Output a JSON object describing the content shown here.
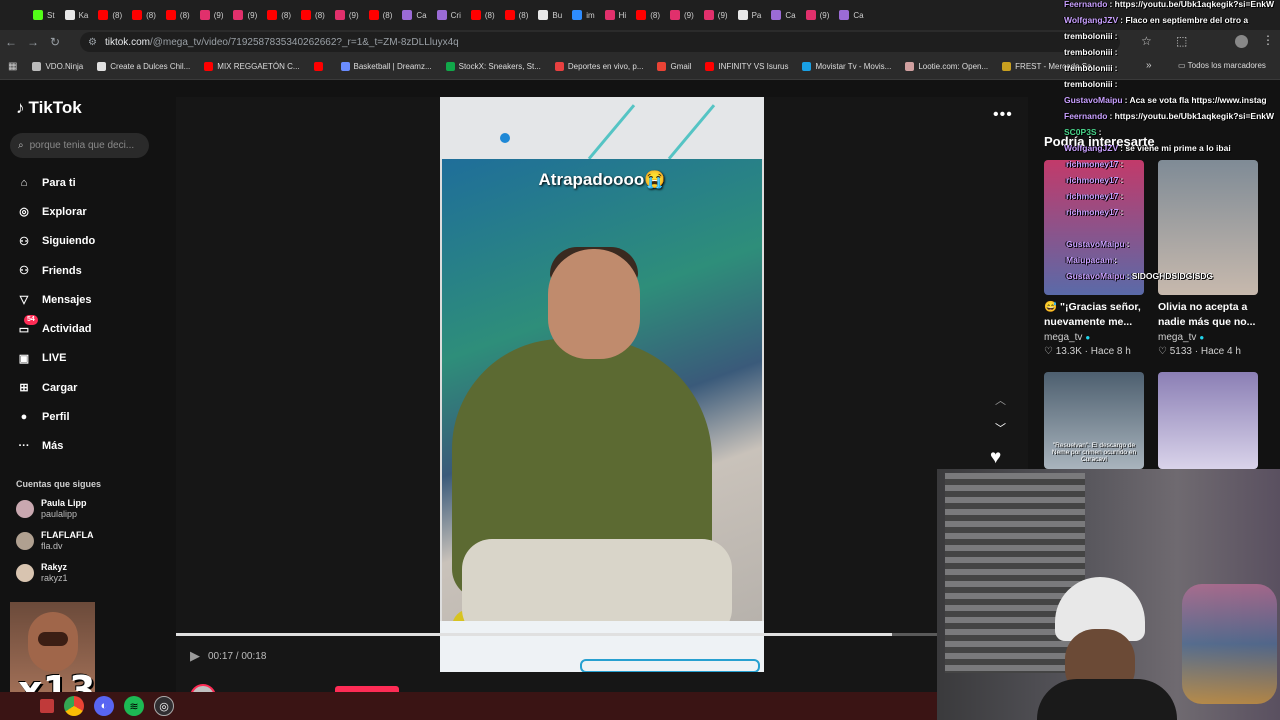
{
  "tabs": [
    {
      "label": "St",
      "color": "#53fc18"
    },
    {
      "label": "Ka",
      "color": "#e8e8e8"
    },
    {
      "label": "(8)",
      "color": "#ff0000"
    },
    {
      "label": "(8)",
      "color": "#ff0000"
    },
    {
      "label": "(8)",
      "color": "#ff0000"
    },
    {
      "label": "(9)",
      "color": "#e1306c"
    },
    {
      "label": "(9)",
      "color": "#e1306c"
    },
    {
      "label": "(8)",
      "color": "#ff0000"
    },
    {
      "label": "(8)",
      "color": "#ff0000"
    },
    {
      "label": "(9)",
      "color": "#e1306c"
    },
    {
      "label": "(8)",
      "color": "#ff0000"
    },
    {
      "label": "Ca",
      "color": "#9b6bd6"
    },
    {
      "label": "Cri",
      "color": "#9b6bd6"
    },
    {
      "label": "(8)",
      "color": "#ff0000"
    },
    {
      "label": "(8)",
      "color": "#ff0000"
    },
    {
      "label": "Bu",
      "color": "#e8e8e8"
    },
    {
      "label": "im",
      "color": "#2d8cff"
    },
    {
      "label": "Hi",
      "color": "#e1306c"
    },
    {
      "label": "(8)",
      "color": "#ff0000"
    },
    {
      "label": "(9)",
      "color": "#e1306c"
    },
    {
      "label": "(9)",
      "color": "#e1306c"
    },
    {
      "label": "Pa",
      "color": "#e8e8e8"
    },
    {
      "label": "Ca",
      "color": "#9b6bd6"
    },
    {
      "label": "(9)",
      "color": "#e1306c"
    },
    {
      "label": "Ca",
      "color": "#9b6bd6"
    }
  ],
  "address": {
    "host": "tiktok.com",
    "path": "/@mega_tv/video/7192587835340262662?_r=1&_t=ZM-8zDLLluyx4q"
  },
  "bookmarks": [
    {
      "label": "VDO.Ninja",
      "color": "#bbbbbb"
    },
    {
      "label": "Create a Dulces Chil...",
      "color": "#e0e0e0"
    },
    {
      "label": "MIX REGGAETÓN C...",
      "color": "#ff0000"
    },
    {
      "label": "",
      "color": "#ff0000"
    },
    {
      "label": "Basketball | Dreamz...",
      "color": "#6a8cff"
    },
    {
      "label": "StockX: Sneakers, St...",
      "color": "#11a84a"
    },
    {
      "label": "Deportes en vivo, p...",
      "color": "#e84040"
    },
    {
      "label": "Gmail",
      "color": "#ea4335"
    },
    {
      "label": "INFINITY VS Isurus",
      "color": "#ff0000"
    },
    {
      "label": "Movistar Tv - Movis...",
      "color": "#19a0e4"
    },
    {
      "label": "Lootie.com: Open...",
      "color": "#d0a0a0"
    },
    {
      "label": "FREST - Mercado Sa...",
      "color": "#c9a020"
    }
  ],
  "bookmarks_all": "Todos los marcadores",
  "tiktok": {
    "logo": "TikTok",
    "search_placeholder": "porque tenia que deci...",
    "nav": [
      {
        "label": "Para ti",
        "icon": "home-icon",
        "glyph": "⌂"
      },
      {
        "label": "Explorar",
        "icon": "compass-icon",
        "glyph": "◎"
      },
      {
        "label": "Siguiendo",
        "icon": "following-icon",
        "glyph": "⚇"
      },
      {
        "label": "Friends",
        "icon": "friends-icon",
        "glyph": "⚇"
      },
      {
        "label": "Mensajes",
        "icon": "messages-icon",
        "glyph": "▽"
      },
      {
        "label": "Actividad",
        "icon": "activity-icon",
        "glyph": "▭",
        "badge": "54"
      },
      {
        "label": "LIVE",
        "icon": "live-icon",
        "glyph": "▣"
      },
      {
        "label": "Cargar",
        "icon": "upload-icon",
        "glyph": "⊞"
      },
      {
        "label": "Perfil",
        "icon": "profile-icon",
        "glyph": "●"
      },
      {
        "label": "Más",
        "icon": "more-icon",
        "glyph": "···"
      }
    ],
    "following_heading": "Cuentas que sigues",
    "following": [
      {
        "name": "Paula Lipp",
        "handle": "paulalipp",
        "color": "#c9a8b0"
      },
      {
        "name": "FLAFLAFLA",
        "handle": "fla.dv",
        "color": "#b0a090"
      },
      {
        "name": "Rakyz",
        "handle": "rakyz1",
        "color": "#d8c4b0"
      }
    ],
    "caption": "Atrapadoooo😭",
    "time": "00:17 / 00:18",
    "progress": 0.94,
    "author": "mega_tv",
    "recommended_heading": "Podría interesarte",
    "cards": [
      {
        "title": "😅 \"¡Gracias señor, nuevamente me...",
        "author": "mega_tv",
        "likes": "13.3K",
        "when": "Hace 8 h",
        "grad": "linear-gradient(#c23a6a,#5a6aa8)"
      },
      {
        "title": "Olivia no acepta a nadie más que no...",
        "author": "mega_tv",
        "likes": "5133",
        "when": "Hace 4 h",
        "grad": "linear-gradient(#7f8b96,#c7b9ad)"
      },
      {
        "title": "",
        "author": "",
        "likes": "",
        "when": "",
        "grad": "linear-gradient(#4d5f6f,#a9b4bd)",
        "text": "\"Resuelvan\": El descargo de Neme por crimen ocurrido en Curacaví"
      },
      {
        "title": "",
        "author": "",
        "likes": "",
        "when": "",
        "grad": "linear-gradient(#8b7fb5,#d9d3ea)"
      }
    ]
  },
  "chat": [
    {
      "user": "Feernando",
      "msg": ": https://youtu.be/Ubk1aqkegik?si=EnkW",
      "color": "#c9a0ff"
    },
    {
      "user": "WolfgangJZV",
      "msg": ": Flaco en septiembre del otro a",
      "color": "#c9a0ff"
    },
    {
      "user": "tremboloniii",
      "msg": ":",
      "color": "#ffffff"
    },
    {
      "user": "tremboloniii",
      "msg": ":",
      "color": "#ffffff"
    },
    {
      "user": "tremboloniii",
      "msg": ":",
      "color": "#ffffff"
    },
    {
      "user": "tremboloniii",
      "msg": ":",
      "color": "#ffffff"
    },
    {
      "user": "GustavoMaipu",
      "msg": ": Aca se vota fla https://www.instag",
      "color": "#c9a0ff"
    },
    {
      "user": "Feernando",
      "msg": ": https://youtu.be/Ubk1aqkegik?si=EnkW",
      "color": "#c9a0ff"
    },
    {
      "user": "SC0P3S",
      "msg": ":",
      "color": "#48d48a"
    },
    {
      "user": "WolfgangJZV",
      "msg": ": se viene mi prime a lo ibai",
      "color": "#c9a0ff"
    },
    {
      "user": "richmoney17",
      "msg": ":",
      "color": "#c9a0ff"
    },
    {
      "user": "richmoney17",
      "msg": ":",
      "color": "#c9a0ff"
    },
    {
      "user": "richmoney17",
      "msg": ":",
      "color": "#c9a0ff"
    },
    {
      "user": "richmoney17",
      "msg": ":",
      "color": "#c9a0ff"
    },
    {
      "user": "GustavoMaipu",
      "msg": ":",
      "color": "#c9a0ff"
    },
    {
      "user": "Maiupacam",
      "msg": ":",
      "color": "#c9a0ff"
    },
    {
      "user": "GustavoMaipu",
      "msg": ": SIDOGHDSIDGISDG",
      "color": "#c9a0ff"
    }
  ],
  "overlay": "x13"
}
